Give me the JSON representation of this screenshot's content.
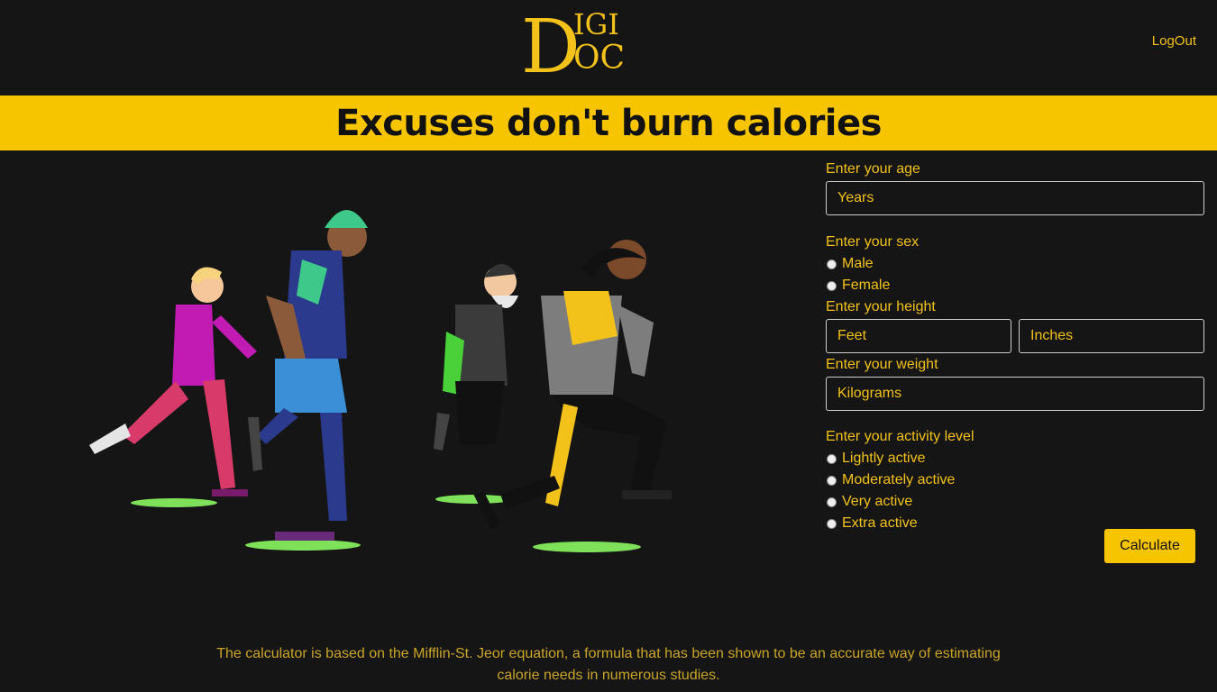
{
  "header": {
    "logo_text_top": "IGI",
    "logo_text_bottom": "OC",
    "logo_letter": "D",
    "logout_label": "LogOut"
  },
  "banner": {
    "title": "Excuses don't burn calories"
  },
  "form": {
    "age": {
      "label": "Enter your age",
      "placeholder": "Years"
    },
    "sex": {
      "label": "Enter your sex",
      "options": [
        "Male",
        "Female"
      ]
    },
    "height": {
      "label": "Enter your height",
      "feet_placeholder": "Feet",
      "inches_placeholder": "Inches"
    },
    "weight": {
      "label": "Enter your weight",
      "placeholder": "Kilograms"
    },
    "activity": {
      "label": "Enter your activity level",
      "options": [
        "Lightly active",
        "Moderately active",
        "Very active",
        "Extra active"
      ]
    },
    "calculate_label": "Calculate"
  },
  "footnote": "The calculator is based on the Mifflin-St. Jeor equation, a formula that has been shown to be an accurate way of estimating calorie needs in numerous studies.",
  "colors": {
    "accent": "#f7c500",
    "text_accent": "#f3c21a",
    "background": "#151515"
  }
}
